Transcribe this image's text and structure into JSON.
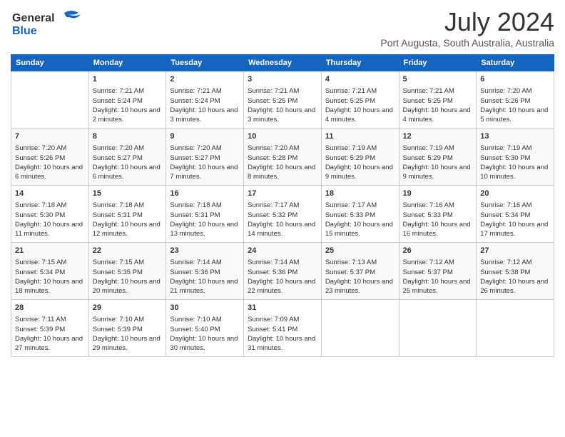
{
  "header": {
    "logo_line1": "General",
    "logo_line2": "Blue",
    "title": "July 2024",
    "location": "Port Augusta, South Australia, Australia"
  },
  "calendar": {
    "columns": [
      "Sunday",
      "Monday",
      "Tuesday",
      "Wednesday",
      "Thursday",
      "Friday",
      "Saturday"
    ],
    "weeks": [
      [
        {
          "day": "",
          "sunrise": "",
          "sunset": "",
          "daylight": ""
        },
        {
          "day": "1",
          "sunrise": "Sunrise: 7:21 AM",
          "sunset": "Sunset: 5:24 PM",
          "daylight": "Daylight: 10 hours and 2 minutes."
        },
        {
          "day": "2",
          "sunrise": "Sunrise: 7:21 AM",
          "sunset": "Sunset: 5:24 PM",
          "daylight": "Daylight: 10 hours and 3 minutes."
        },
        {
          "day": "3",
          "sunrise": "Sunrise: 7:21 AM",
          "sunset": "Sunset: 5:25 PM",
          "daylight": "Daylight: 10 hours and 3 minutes."
        },
        {
          "day": "4",
          "sunrise": "Sunrise: 7:21 AM",
          "sunset": "Sunset: 5:25 PM",
          "daylight": "Daylight: 10 hours and 4 minutes."
        },
        {
          "day": "5",
          "sunrise": "Sunrise: 7:21 AM",
          "sunset": "Sunset: 5:25 PM",
          "daylight": "Daylight: 10 hours and 4 minutes."
        },
        {
          "day": "6",
          "sunrise": "Sunrise: 7:20 AM",
          "sunset": "Sunset: 5:26 PM",
          "daylight": "Daylight: 10 hours and 5 minutes."
        }
      ],
      [
        {
          "day": "7",
          "sunrise": "Sunrise: 7:20 AM",
          "sunset": "Sunset: 5:26 PM",
          "daylight": "Daylight: 10 hours and 6 minutes."
        },
        {
          "day": "8",
          "sunrise": "Sunrise: 7:20 AM",
          "sunset": "Sunset: 5:27 PM",
          "daylight": "Daylight: 10 hours and 6 minutes."
        },
        {
          "day": "9",
          "sunrise": "Sunrise: 7:20 AM",
          "sunset": "Sunset: 5:27 PM",
          "daylight": "Daylight: 10 hours and 7 minutes."
        },
        {
          "day": "10",
          "sunrise": "Sunrise: 7:20 AM",
          "sunset": "Sunset: 5:28 PM",
          "daylight": "Daylight: 10 hours and 8 minutes."
        },
        {
          "day": "11",
          "sunrise": "Sunrise: 7:19 AM",
          "sunset": "Sunset: 5:29 PM",
          "daylight": "Daylight: 10 hours and 9 minutes."
        },
        {
          "day": "12",
          "sunrise": "Sunrise: 7:19 AM",
          "sunset": "Sunset: 5:29 PM",
          "daylight": "Daylight: 10 hours and 9 minutes."
        },
        {
          "day": "13",
          "sunrise": "Sunrise: 7:19 AM",
          "sunset": "Sunset: 5:30 PM",
          "daylight": "Daylight: 10 hours and 10 minutes."
        }
      ],
      [
        {
          "day": "14",
          "sunrise": "Sunrise: 7:18 AM",
          "sunset": "Sunset: 5:30 PM",
          "daylight": "Daylight: 10 hours and 11 minutes."
        },
        {
          "day": "15",
          "sunrise": "Sunrise: 7:18 AM",
          "sunset": "Sunset: 5:31 PM",
          "daylight": "Daylight: 10 hours and 12 minutes."
        },
        {
          "day": "16",
          "sunrise": "Sunrise: 7:18 AM",
          "sunset": "Sunset: 5:31 PM",
          "daylight": "Daylight: 10 hours and 13 minutes."
        },
        {
          "day": "17",
          "sunrise": "Sunrise: 7:17 AM",
          "sunset": "Sunset: 5:32 PM",
          "daylight": "Daylight: 10 hours and 14 minutes."
        },
        {
          "day": "18",
          "sunrise": "Sunrise: 7:17 AM",
          "sunset": "Sunset: 5:33 PM",
          "daylight": "Daylight: 10 hours and 15 minutes."
        },
        {
          "day": "19",
          "sunrise": "Sunrise: 7:16 AM",
          "sunset": "Sunset: 5:33 PM",
          "daylight": "Daylight: 10 hours and 16 minutes."
        },
        {
          "day": "20",
          "sunrise": "Sunrise: 7:16 AM",
          "sunset": "Sunset: 5:34 PM",
          "daylight": "Daylight: 10 hours and 17 minutes."
        }
      ],
      [
        {
          "day": "21",
          "sunrise": "Sunrise: 7:15 AM",
          "sunset": "Sunset: 5:34 PM",
          "daylight": "Daylight: 10 hours and 18 minutes."
        },
        {
          "day": "22",
          "sunrise": "Sunrise: 7:15 AM",
          "sunset": "Sunset: 5:35 PM",
          "daylight": "Daylight: 10 hours and 20 minutes."
        },
        {
          "day": "23",
          "sunrise": "Sunrise: 7:14 AM",
          "sunset": "Sunset: 5:36 PM",
          "daylight": "Daylight: 10 hours and 21 minutes."
        },
        {
          "day": "24",
          "sunrise": "Sunrise: 7:14 AM",
          "sunset": "Sunset: 5:36 PM",
          "daylight": "Daylight: 10 hours and 22 minutes."
        },
        {
          "day": "25",
          "sunrise": "Sunrise: 7:13 AM",
          "sunset": "Sunset: 5:37 PM",
          "daylight": "Daylight: 10 hours and 23 minutes."
        },
        {
          "day": "26",
          "sunrise": "Sunrise: 7:12 AM",
          "sunset": "Sunset: 5:37 PM",
          "daylight": "Daylight: 10 hours and 25 minutes."
        },
        {
          "day": "27",
          "sunrise": "Sunrise: 7:12 AM",
          "sunset": "Sunset: 5:38 PM",
          "daylight": "Daylight: 10 hours and 26 minutes."
        }
      ],
      [
        {
          "day": "28",
          "sunrise": "Sunrise: 7:11 AM",
          "sunset": "Sunset: 5:39 PM",
          "daylight": "Daylight: 10 hours and 27 minutes."
        },
        {
          "day": "29",
          "sunrise": "Sunrise: 7:10 AM",
          "sunset": "Sunset: 5:39 PM",
          "daylight": "Daylight: 10 hours and 29 minutes."
        },
        {
          "day": "30",
          "sunrise": "Sunrise: 7:10 AM",
          "sunset": "Sunset: 5:40 PM",
          "daylight": "Daylight: 10 hours and 30 minutes."
        },
        {
          "day": "31",
          "sunrise": "Sunrise: 7:09 AM",
          "sunset": "Sunset: 5:41 PM",
          "daylight": "Daylight: 10 hours and 31 minutes."
        },
        {
          "day": "",
          "sunrise": "",
          "sunset": "",
          "daylight": ""
        },
        {
          "day": "",
          "sunrise": "",
          "sunset": "",
          "daylight": ""
        },
        {
          "day": "",
          "sunrise": "",
          "sunset": "",
          "daylight": ""
        }
      ]
    ]
  }
}
